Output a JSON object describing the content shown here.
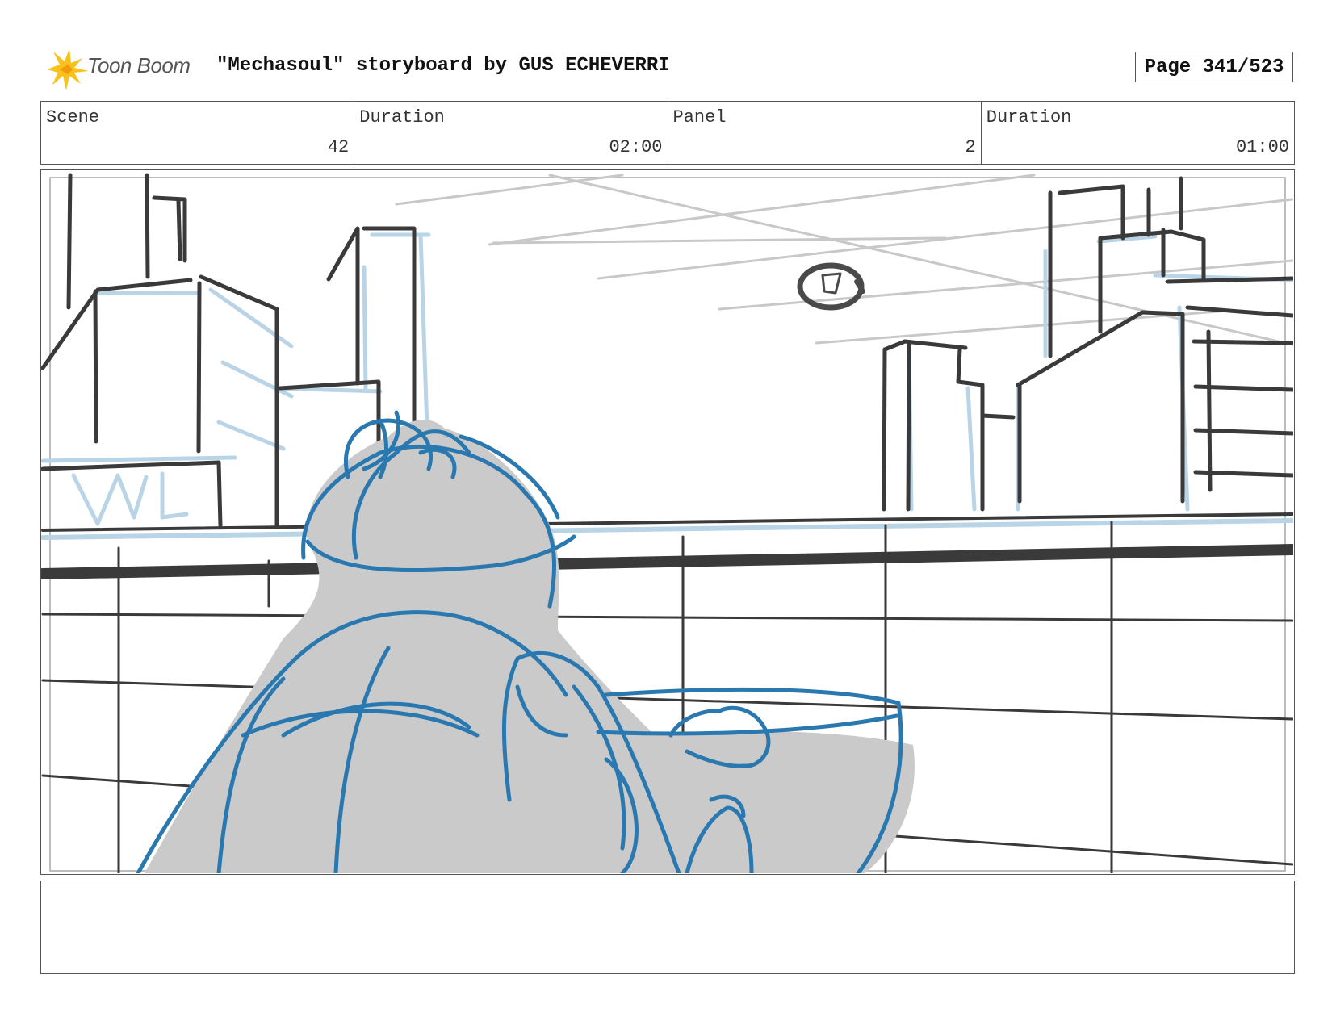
{
  "header": {
    "logo_text": "Toon Boom",
    "title": "\"Mechasoul\" storyboard by GUS ECHEVERRI",
    "page": "Page 341/523"
  },
  "info": {
    "scene_label": "Scene",
    "scene_value": "42",
    "scene_duration_label": "Duration",
    "scene_duration_value": "02:00",
    "panel_label": "Panel",
    "panel_value": "2",
    "panel_duration_label": "Duration",
    "panel_duration_value": "01:00"
  },
  "caption": {
    "text": ""
  },
  "colors": {
    "ink": "#3a3a3a",
    "blue_line": "#2a78b0",
    "light_blue": "#b9d4e6",
    "fill_gray": "#cacaca",
    "logo_yellow": "#f7c21b"
  }
}
